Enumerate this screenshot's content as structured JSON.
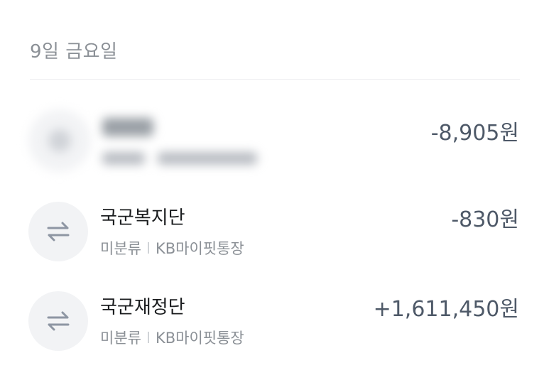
{
  "date_header": "9일 금요일",
  "transactions": [
    {
      "name": "",
      "category": "",
      "account": "",
      "amount": "-8,905원",
      "icon": "blurred-merchant-icon",
      "blurred": true
    },
    {
      "name": "국군복지단",
      "category": "미분류",
      "account": "KB마이핏통장",
      "amount": "-830원",
      "icon": "transfer-arrows-icon"
    },
    {
      "name": "국군재정단",
      "category": "미분류",
      "account": "KB마이핏통장",
      "amount": "+1,611,450원",
      "icon": "transfer-arrows-icon"
    }
  ],
  "colors": {
    "muted_text": "#8b9096",
    "amount_text": "#4e5968",
    "icon_bg": "#f2f3f5",
    "icon_stroke": "#8e96a3"
  }
}
